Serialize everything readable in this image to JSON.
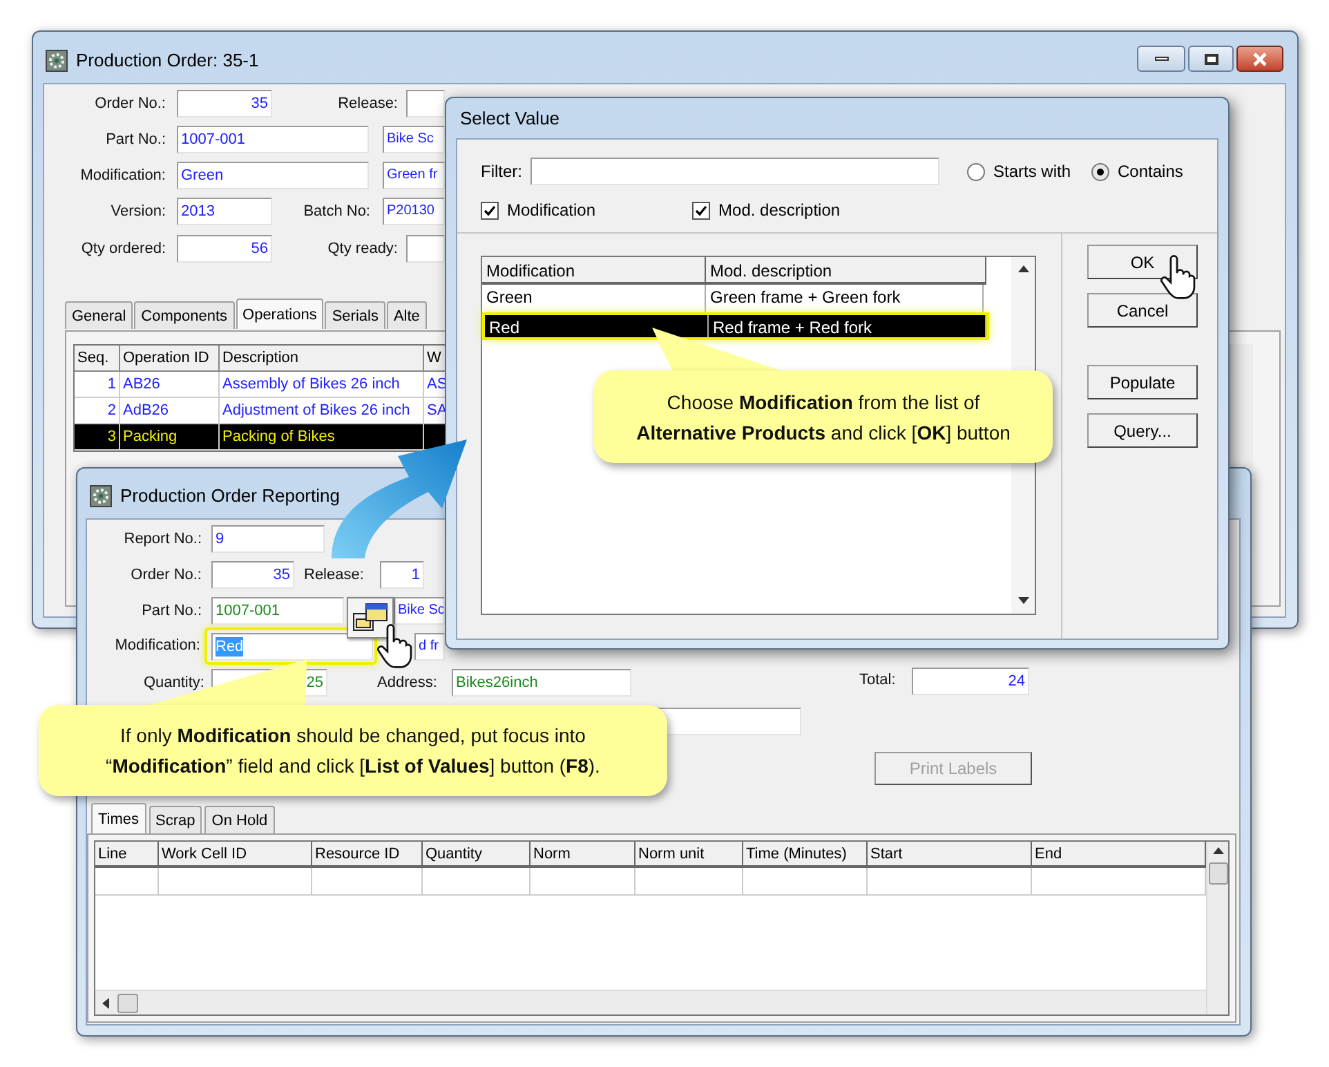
{
  "production_order_window": {
    "title": "Production Order: 35-1",
    "labels": [
      "Order No.:",
      "Release:",
      "Part No.:",
      "Modification:",
      "Version:",
      "Batch No:",
      "Qty ordered:",
      "Qty ready:"
    ],
    "fields": [
      {
        "value": "35"
      },
      {
        "value": "1007-001"
      },
      {
        "value": "Bike Sc"
      },
      {
        "value": "Green"
      },
      {
        "value": "Green fr"
      },
      {
        "value": "2013"
      },
      {
        "value": "P20130"
      },
      {
        "value": "56"
      }
    ],
    "tabs": [
      {
        "label": "General",
        "selected": false
      },
      {
        "label": "Components",
        "selected": false
      },
      {
        "label": "Operations",
        "selected": true
      },
      {
        "label": "Serials",
        "selected": false
      },
      {
        "label": "Alte",
        "selected": false
      }
    ],
    "operations_table": {
      "columns": [
        "Seq.",
        "Operation ID",
        "Description",
        "W"
      ],
      "rows": [
        {
          "cells": [
            "1",
            "AB26",
            "Assembly of Bikes 26 inch",
            "AS"
          ],
          "selected": false
        },
        {
          "cells": [
            "2",
            "AdB26",
            "Adjustment of Bikes 26 inch",
            "SA"
          ],
          "selected": false
        },
        {
          "cells": [
            "3",
            "Packing",
            "Packing of Bikes"
          ],
          "selected": true
        }
      ]
    }
  },
  "select_value_dialog": {
    "title": "Select Value",
    "filter_label": "Filter:",
    "match_options": [
      {
        "label": "Starts with",
        "selected": false
      },
      {
        "label": "Contains",
        "selected": true
      }
    ],
    "search_columns": [
      {
        "label": "Modification",
        "checked": true
      },
      {
        "label": "Mod. description",
        "checked": true
      }
    ],
    "list": {
      "columns": [
        "Modification",
        "Mod. description"
      ],
      "rows": [
        {
          "cells": [
            "Green",
            "Green frame + Green fork"
          ],
          "selected": false
        },
        {
          "cells": [
            "Red",
            "Red frame + Red fork"
          ],
          "selected": true
        }
      ]
    },
    "buttons": [
      "OK",
      "Cancel",
      "Populate",
      "Query..."
    ]
  },
  "reporting_window": {
    "title": "Production Order Reporting",
    "labels": [
      "Report No.:",
      "Order No.:",
      "Release:",
      "Part No.:",
      "Modification:",
      "Quantity:",
      "Address:",
      "Total:"
    ],
    "fields": [
      {
        "value": "9",
        "color": "#2020ff",
        "selected": false
      },
      {
        "value": "35",
        "color": "#2020ff",
        "selected": false
      },
      {
        "value": "1",
        "color": "#2020ff",
        "selected": false
      },
      {
        "value": "1007-001",
        "color": "#1a8a1a",
        "selected": false
      },
      {
        "value": "Bike Sc",
        "color": "#2020ff",
        "selected": false
      },
      {
        "value": "Red",
        "selected": true
      },
      {
        "value": "d fr",
        "color": "#2020ff",
        "selected": false
      },
      {
        "value": "25",
        "color": "#1a8a1a",
        "selected": false
      },
      {
        "value": "Bikes26inch",
        "color": "#1a8a1a",
        "selected": false
      },
      {
        "value": "24",
        "color": "#2020ff",
        "selected": false
      }
    ],
    "print_button": {
      "label": "Print Labels",
      "disabled": true
    },
    "tabs": [
      {
        "label": "Times",
        "selected": true
      },
      {
        "label": "Scrap",
        "selected": false
      },
      {
        "label": "On Hold",
        "selected": false
      }
    ],
    "times_table": {
      "columns": [
        "Line",
        "Work Cell ID",
        "Resource ID",
        "Quantity",
        "Norm",
        "Norm unit",
        "Time (Minutes)",
        "Start",
        "End"
      ]
    }
  },
  "callouts": [
    {
      "lines": [
        "Choose **Modification** from the list of",
        "**Alternative Products** and click [**OK**] button"
      ]
    },
    {
      "lines": [
        "If only **Modification** should be changed, put focus into",
        "“**Modification**” field and click [**List of Values**] button (**F8**)."
      ]
    }
  ]
}
